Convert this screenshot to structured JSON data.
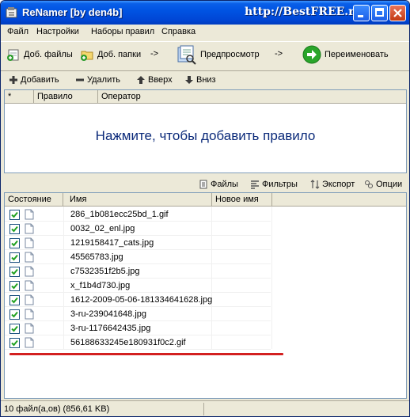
{
  "window": {
    "title": "ReNamer  [by den4b]",
    "watermark": "http://BestFREE.ru"
  },
  "menu": {
    "items": [
      "Файл",
      "Настройки",
      "Наборы правил",
      "Справка"
    ]
  },
  "toolbar": {
    "add_files": "Доб. файлы",
    "add_folders": "Доб. папки",
    "arrow1": "->",
    "preview": "Предпросмотр",
    "arrow2": "->",
    "rename": "Переименовать"
  },
  "rules_toolbar": {
    "add": "Добавить",
    "remove": "Удалить",
    "up": "Вверх",
    "down": "Вниз"
  },
  "rules_table": {
    "columns": [
      "*",
      "Правило",
      "Оператор"
    ],
    "empty_prompt": "Нажмите, чтобы добавить правило"
  },
  "files_toolbar": {
    "files": "Файлы",
    "filters": "Фильтры",
    "export": "Экспорт",
    "options": "Опции"
  },
  "files_table": {
    "columns": [
      "Состояние",
      "Имя",
      "Новое имя"
    ],
    "rows": [
      {
        "name": "286_1b081ecc25bd_1.gif",
        "checked": true
      },
      {
        "name": "0032_02_enl.jpg",
        "checked": true
      },
      {
        "name": "1219158417_cats.jpg",
        "checked": true
      },
      {
        "name": "45565783.jpg",
        "checked": true
      },
      {
        "name": "c7532351f2b5.jpg",
        "checked": true
      },
      {
        "name": "x_f1b4d730.jpg",
        "checked": true
      },
      {
        "name": "1612-2009-05-06-181334641628.jpg",
        "checked": true
      },
      {
        "name": "3-ru-239041648.jpg",
        "checked": true
      },
      {
        "name": "3-ru-1176642435.jpg",
        "checked": true
      },
      {
        "name": "56188633245e180931f0c2.gif",
        "checked": true
      }
    ]
  },
  "status": {
    "text": "10 файл(а,ов) (856,61 KB)"
  },
  "colors": {
    "titlebar": "#0054e3",
    "prompt_text": "#0b2a7a",
    "highlight_line": "#d32020",
    "check_green": "#21a121"
  }
}
